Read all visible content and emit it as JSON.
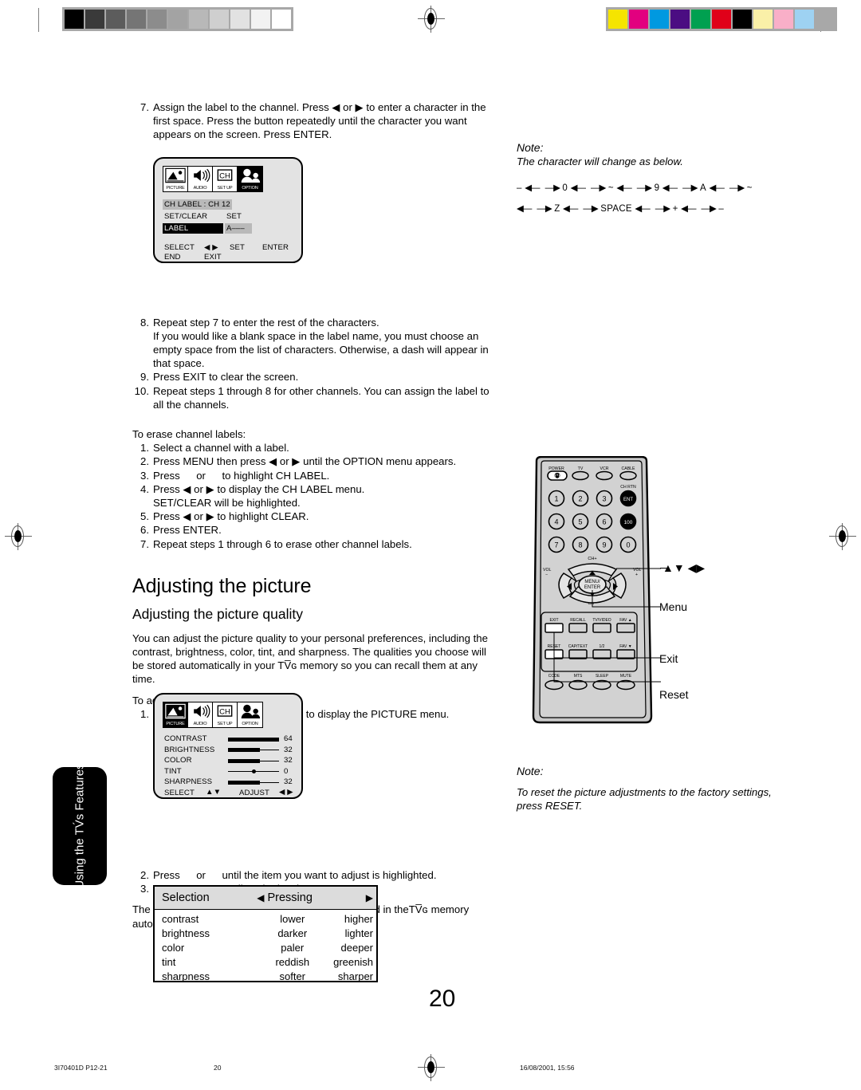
{
  "document": {
    "page_number": "20",
    "side_tab": "Using the TV́s Features"
  },
  "calibration": {
    "gray_swatches": [
      "#000000",
      "#3a3a3a",
      "#5c5c5c",
      "#757575",
      "#8c8c8c",
      "#a3a3a3",
      "#b8b8b8",
      "#cfcfcf",
      "#e2e2e2",
      "#f2f2f2",
      "#ffffff"
    ],
    "color_swatches": [
      "#f5e400",
      "#e2007f",
      "#0099e0",
      "#4b0d82",
      "#00a050",
      "#e00019",
      "#000000",
      "#faf0a8",
      "#f9afc8",
      "#9ed2f2",
      "#a8a8a8"
    ]
  },
  "left_column": {
    "step7": {
      "num": "7.",
      "text": "Assign the label to the channel. Press ◀ or ▶ to enter a character in the first space. Press the button repeatedly until the character you want appears on the screen. Press ENTER."
    },
    "osd_chlabel": {
      "icons": [
        {
          "caption": "PICTURE",
          "icon": "picture-icon",
          "selected": false
        },
        {
          "caption": "AUDIO",
          "icon": "audio-speaker-icon",
          "selected": false
        },
        {
          "caption": "SET UP",
          "icon": "ch-setup-icon",
          "selected": false
        },
        {
          "caption": "OPTION",
          "icon": "option-people-icon",
          "selected": true
        }
      ],
      "line_chlabel": "CH LABEL : CH 12",
      "line_setclear_label": "SET/CLEAR",
      "line_setclear_value": "SET",
      "line_label_label": "LABEL",
      "line_label_value": "A–––",
      "foot_select": "SELECT",
      "foot_select_arrows": "◀ ▶",
      "foot_set": "SET",
      "foot_enter": "ENTER",
      "foot_end": "END",
      "foot_exit": "EXIT"
    },
    "step8": {
      "num": "8.",
      "line1": "Repeat step 7 to enter the rest of the characters.",
      "line2": "If you would like a blank space in the label name, you must choose an empty space from the list of characters. Otherwise, a dash will appear in that space."
    },
    "step9": {
      "num": "9.",
      "text": "Press EXIT to clear the screen."
    },
    "step10": {
      "num": "10.",
      "text": "Repeat steps 1 through 8 for other channels. You can assign the label to all the channels."
    },
    "erase_heading": "To erase channel labels:",
    "erase_steps": [
      {
        "num": "1.",
        "text": "Select a channel with a label."
      },
      {
        "num": "2.",
        "text": "Press MENU then press ◀ or ▶ until the OPTION menu appears."
      },
      {
        "num": "3.",
        "text": "Press   or   to highlight CH LABEL."
      },
      {
        "num": "4.",
        "text": "Press ◀ or ▶ to display the CH LABEL menu."
      },
      {
        "num": "",
        "text": "SET/CLEAR will be highlighted."
      },
      {
        "num": "5.",
        "text": "Press ◀ or ▶ to highlight CLEAR."
      },
      {
        "num": "6.",
        "text": "Press ENTER."
      },
      {
        "num": "7.",
        "text": "Repeat steps 1 through 6 to erase other channel labels."
      }
    ],
    "h1": "Adjusting the picture",
    "h2": "Adjusting the picture quality",
    "intro": "You can adjust the picture quality to your personal preferences, including the contrast, brightness, color, tint, and sharpness. The qualities you choose will be stored automatically in your TV̅ɢ memory so you can recall them at any time.",
    "adjust_heading": "To adjust the picture quality:",
    "adjust_step1": {
      "num": "1.",
      "text": "Press MENU, then press ◀ or ▶ to display the PICTURE menu."
    },
    "osd_picture": {
      "icons": [
        {
          "caption": "PICTURE",
          "icon": "picture-icon",
          "selected": true
        },
        {
          "caption": "AUDIO",
          "icon": "audio-speaker-icon",
          "selected": false
        },
        {
          "caption": "SET UP",
          "icon": "ch-setup-icon",
          "selected": false
        },
        {
          "caption": "OPTION",
          "icon": "option-people-icon",
          "selected": false
        }
      ],
      "rows": [
        {
          "label": "CONTRAST",
          "value": "64",
          "fill": 1.0,
          "type": "bar"
        },
        {
          "label": "BRIGHTNESS",
          "value": "32",
          "fill": 0.62,
          "type": "bar"
        },
        {
          "label": "COLOR",
          "value": "32",
          "fill": 0.62,
          "type": "bar"
        },
        {
          "label": "TINT",
          "value": "0",
          "fill": 0.5,
          "type": "dot"
        },
        {
          "label": "SHARPNESS",
          "value": "32",
          "fill": 0.62,
          "type": "bar"
        }
      ],
      "foot_select": "SELECT",
      "foot_select_arrows": "▲▼",
      "foot_adjust": "ADJUST",
      "foot_adjust_arrows": "◀ ▶"
    },
    "adjust_step2": {
      "num": "2.",
      "text": "Press   or   until the item you want to adjust is highlighted."
    },
    "adjust_step3": {
      "num": "3.",
      "text": "Press ◀ or ▶ to adjust the level."
    },
    "stored_note": "The PICTURE items you have adjusted will be stored in theTV̅ɢ memory automatically."
  },
  "table": {
    "header": {
      "col0": "Selection",
      "col1_left_arrow": "◀",
      "col1": "Pressing",
      "col2_right_arrow": "▶"
    },
    "rows": [
      {
        "selection": "contrast",
        "left": "lower",
        "right": "higher"
      },
      {
        "selection": "brightness",
        "left": "darker",
        "right": "lighter"
      },
      {
        "selection": "color",
        "left": "paler",
        "right": "deeper"
      },
      {
        "selection": "tint",
        "left": "reddish",
        "right": "greenish"
      },
      {
        "selection": "sharpness",
        "left": "softer",
        "right": "sharper"
      }
    ]
  },
  "right_column": {
    "note1_title": "Note:",
    "note1_body": "The character will change as below.",
    "charseq_line1": [
      "–",
      "0",
      "~",
      "9",
      "A",
      "~"
    ],
    "charseq_line2": [
      "Z",
      "SPACE",
      "+",
      "–"
    ],
    "note2_title": "Note:",
    "note2_body": "To reset the picture adjustments to the factory settings, press RESET."
  },
  "remote": {
    "top_row": [
      {
        "label": "POWER",
        "shape": "power"
      },
      {
        "label": "TV",
        "shape": "oval"
      },
      {
        "label": "VCR",
        "shape": "oval"
      },
      {
        "label": "CABLE",
        "shape": "oval"
      }
    ],
    "chrtn_label": "CH RTN",
    "keypad": [
      [
        "1",
        "2",
        "3",
        "ENT"
      ],
      [
        "4",
        "5",
        "6",
        "100"
      ],
      [
        "7",
        "8",
        "9",
        "0"
      ]
    ],
    "ch_up": "CH+",
    "ch_down": "CH–",
    "vol_minus_label": "VOL",
    "vol_minus_sign": "–",
    "vol_plus_label": "VOL",
    "vol_plus_sign": "+",
    "menu_enter_line1": "MENU/",
    "menu_enter_line2": "ENTER",
    "fn_row1": [
      "EXIT",
      "RECALL",
      "TV/VIDEO",
      "FAV ▲"
    ],
    "fn_row2": [
      "RESET",
      "CAP/TEXT",
      "1/2",
      "FAV ▼"
    ],
    "fn_row3": [
      "CODE",
      "MTS",
      "SLEEP",
      "MUTE"
    ],
    "callouts": [
      {
        "label": "▲▼ ◀▶",
        "name": "arrows"
      },
      {
        "label": "Menu",
        "name": "menu"
      },
      {
        "label": "Exit",
        "name": "exit"
      },
      {
        "label": "Reset",
        "name": "reset"
      }
    ]
  },
  "footer": {
    "left": "3I70401D P12-21",
    "center": "20",
    "right": "16/08/2001, 15:56"
  }
}
